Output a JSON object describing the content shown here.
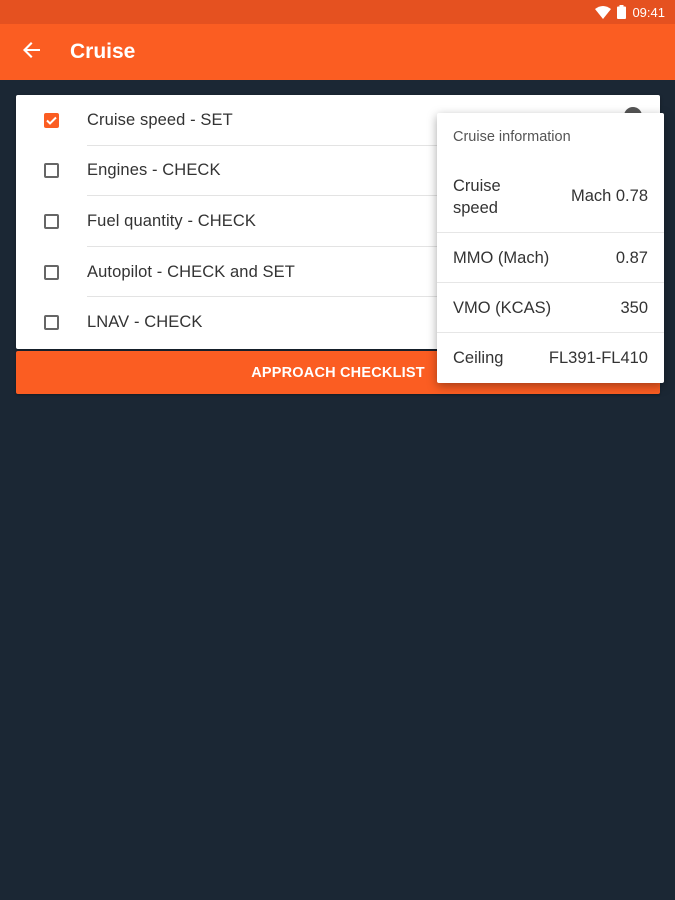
{
  "status_bar": {
    "time": "09:41",
    "icons": [
      "wifi-icon",
      "battery-icon"
    ]
  },
  "app_bar": {
    "title": "Cruise",
    "back_icon": "arrow-back-icon"
  },
  "checklist": {
    "items": [
      {
        "label": "Cruise speed - SET",
        "checked": true
      },
      {
        "label": "Engines - CHECK",
        "checked": false
      },
      {
        "label": "Fuel quantity - CHECK",
        "checked": false
      },
      {
        "label": "Autopilot - CHECK and SET",
        "checked": false
      },
      {
        "label": "LNAV - CHECK",
        "checked": false
      }
    ]
  },
  "approach_button": {
    "label": "APPROACH CHECKLIST"
  },
  "popup": {
    "title": "Cruise information",
    "rows": [
      {
        "name": "Cruise speed",
        "value": "Mach 0.78"
      },
      {
        "name": "MMO (Mach)",
        "value": "0.87"
      },
      {
        "name": "VMO (KCAS)",
        "value": "350"
      },
      {
        "name": "Ceiling",
        "value": "FL391-FL410"
      }
    ]
  },
  "colors": {
    "accent": "#fb5d22",
    "status_bar": "#e55120",
    "background": "#1b2734"
  }
}
